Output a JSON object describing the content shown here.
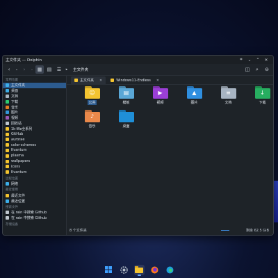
{
  "window": {
    "title": "主文件夹 — Dolphin"
  },
  "toolbar": {
    "breadcrumb": "主文件夹"
  },
  "sidebar": {
    "sections": [
      {
        "label": "常用位置",
        "items": [
          {
            "label": "主文件夹",
            "icon": "home-icon",
            "color": "#3daee9",
            "selected": true
          },
          {
            "label": "桌面",
            "icon": "desktop-icon",
            "color": "#3daee9"
          },
          {
            "label": "文档",
            "icon": "documents-icon",
            "color": "#aab6c2"
          },
          {
            "label": "下载",
            "icon": "downloads-icon",
            "color": "#2ecc71"
          },
          {
            "label": "音乐",
            "icon": "music-icon",
            "color": "#e67e22"
          },
          {
            "label": "图片",
            "icon": "pictures-icon",
            "color": "#3498db"
          },
          {
            "label": "视频",
            "icon": "videos-icon",
            "color": "#9b59b6"
          },
          {
            "label": "回收站",
            "icon": "trash-icon",
            "color": "#c0c7cf"
          },
          {
            "label": "1k-We全系列",
            "icon": "folder-icon",
            "color": "#f4c430"
          },
          {
            "label": "GitHub",
            "icon": "folder-icon",
            "color": "#f4c430"
          },
          {
            "label": "aurorae",
            "icon": "folder-icon",
            "color": "#f4c430"
          },
          {
            "label": "color-schemes",
            "icon": "folder-icon",
            "color": "#f4c430"
          },
          {
            "label": "Kvantum",
            "icon": "folder-icon",
            "color": "#f4c430"
          },
          {
            "label": "plasma",
            "icon": "folder-icon",
            "color": "#f4c430"
          },
          {
            "label": "wallpapers",
            "icon": "folder-icon",
            "color": "#f4c430"
          },
          {
            "label": "icons",
            "icon": "folder-icon",
            "color": "#f4c430"
          },
          {
            "label": "Kvantum",
            "icon": "folder-icon",
            "color": "#f4c430"
          }
        ]
      },
      {
        "label": "远程位置",
        "items": [
          {
            "label": "网络",
            "icon": "network-icon",
            "color": "#3daee9"
          }
        ]
      },
      {
        "label": "最近使用",
        "items": [
          {
            "label": "最近文件",
            "icon": "recent-files-icon",
            "color": "#f4c430"
          },
          {
            "label": "最近位置",
            "icon": "recent-locations-icon",
            "color": "#3daee9"
          }
        ]
      },
      {
        "label": "搜索文件",
        "items": [
          {
            "label": "在 rain 中搜索 Github",
            "icon": "search-icon",
            "color": "#c0c7cf"
          },
          {
            "label": "在 rain 中搜索 Github",
            "icon": "search-icon",
            "color": "#c0c7cf"
          }
        ]
      },
      {
        "label": "存储设备",
        "items": []
      }
    ]
  },
  "tabs": [
    {
      "label": "主文件夹",
      "current": true
    },
    {
      "label": "Windows11-Endless",
      "current": false
    }
  ],
  "files": [
    {
      "label": "公共",
      "color": "#f4c430",
      "glyph": "☺",
      "selected": true
    },
    {
      "label": "模板",
      "color": "#5aa7d6",
      "glyph": "▤"
    },
    {
      "label": "视频",
      "color": "#9b3fd6",
      "glyph": "▶"
    },
    {
      "label": "图片",
      "color": "#2f8fe0",
      "glyph": "▲"
    },
    {
      "label": "文档",
      "color": "#a7b4c2",
      "glyph": "≡"
    },
    {
      "label": "下载",
      "color": "#27ae60",
      "glyph": "↓"
    },
    {
      "label": "音乐",
      "color": "#e9884a",
      "glyph": "♪"
    },
    {
      "label": "桌面",
      "color": "#1f8fd8",
      "glyph": ""
    }
  ],
  "status": {
    "count": "8 个文件夹",
    "free": "剩余 62.5 GiB"
  },
  "taskbar": [
    {
      "icon": "start-icon"
    },
    {
      "icon": "settings-icon"
    },
    {
      "icon": "file-manager-icon"
    },
    {
      "icon": "firefox-icon"
    },
    {
      "icon": "edge-icon"
    }
  ]
}
